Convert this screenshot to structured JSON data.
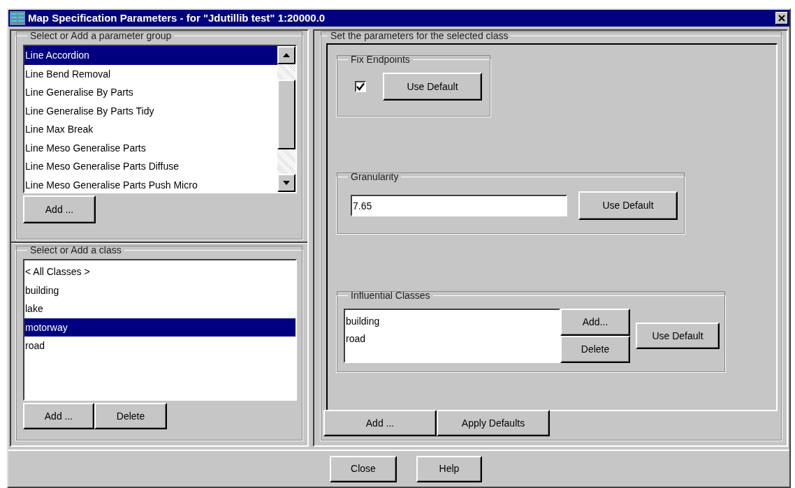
{
  "window": {
    "title": "Map Specification Parameters - for \"Jdutillib test\" 1:20000.0"
  },
  "groups_panel": {
    "title": "Select or Add a parameter group",
    "items": [
      {
        "label": "Line Accordion",
        "selected": true
      },
      {
        "label": "Line Bend Removal",
        "selected": false
      },
      {
        "label": "Line Generalise By Parts",
        "selected": false
      },
      {
        "label": "Line Generalise By Parts Tidy",
        "selected": false
      },
      {
        "label": "Line Max Break",
        "selected": false
      },
      {
        "label": "Line Meso Generalise Parts",
        "selected": false
      },
      {
        "label": "Line Meso Generalise Parts Diffuse",
        "selected": false
      },
      {
        "label": "Line Meso Generalise Parts Push Micro",
        "selected": false
      }
    ],
    "buttons": [
      "Add ..."
    ]
  },
  "classes_panel": {
    "title": "Select or Add a class",
    "items": [
      {
        "label": "< All Classes >",
        "selected": false
      },
      {
        "label": "building",
        "selected": false
      },
      {
        "label": "lake",
        "selected": false
      },
      {
        "label": "motorway",
        "selected": true
      },
      {
        "label": "road",
        "selected": false
      }
    ],
    "buttons": [
      "Add ...",
      "Delete"
    ]
  },
  "parameters_panel": {
    "title": "Set the parameters for the selected class",
    "fix_endpoints": {
      "title": "Fix Endpoints",
      "checked": true,
      "button": "Use Default"
    },
    "granularity": {
      "title": "Granularity",
      "value": "7.65",
      "button": "Use Default"
    },
    "influential_classes": {
      "title": "Influential Classes",
      "items": [
        "building",
        "road"
      ],
      "buttons": [
        "Add...",
        "Delete"
      ],
      "default_button": "Use Default"
    },
    "buttons": [
      "Add ...",
      "Apply Defaults"
    ]
  },
  "footer_buttons": [
    "Close",
    "Help"
  ]
}
